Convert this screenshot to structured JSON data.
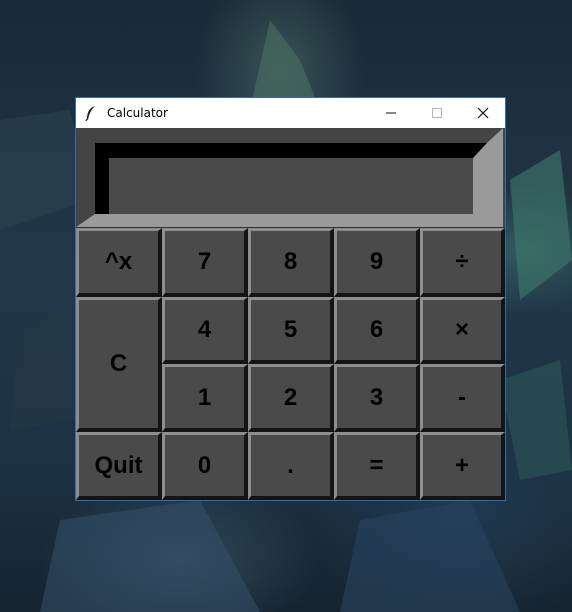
{
  "window": {
    "title": "Calculator",
    "icon": "feather-icon",
    "controls": [
      "minimize-icon",
      "maximize-icon",
      "close-icon"
    ]
  },
  "display": {
    "value": ""
  },
  "buttons": {
    "power": "^x",
    "seven": "7",
    "eight": "8",
    "nine": "9",
    "divide": "÷",
    "clear": "C",
    "four": "4",
    "five": "5",
    "six": "6",
    "multiply": "×",
    "one": "1",
    "two": "2",
    "three": "3",
    "minus": "-",
    "quit": "Quit",
    "zero": "0",
    "decimal": ".",
    "equals": "=",
    "plus": "+"
  },
  "colors": {
    "window_frame": "#2a6fb0",
    "button_face": "#4a4a4a",
    "button_highlight": "#8e8e8e",
    "button_shadow": "#141414",
    "display_face": "#4a4a4a"
  }
}
